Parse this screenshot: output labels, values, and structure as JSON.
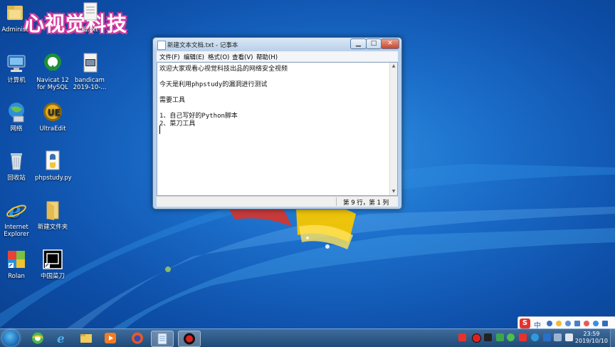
{
  "watermark": "心视觉科技",
  "desktop_icons": [
    {
      "key": "admin",
      "label": "Administ"
    },
    {
      "key": "txtfile",
      "label": "档.txt"
    },
    {
      "key": "computer",
      "label": "计算机"
    },
    {
      "key": "navicat",
      "label": "Navicat 12 for MySQL"
    },
    {
      "key": "bandicam",
      "label": "bandicam 2019-10-..."
    },
    {
      "key": "network",
      "label": "网络"
    },
    {
      "key": "ultraedit",
      "label": "UltraEdit"
    },
    {
      "key": "recycle",
      "label": "回收站"
    },
    {
      "key": "phpstudy",
      "label": "phpstudy.py"
    },
    {
      "key": "ie",
      "label": "Internet Explorer"
    },
    {
      "key": "newfolder",
      "label": "新建文件夹"
    },
    {
      "key": "rolan",
      "label": "Rolan"
    },
    {
      "key": "zhongguocaidao",
      "label": "中国菜刀"
    }
  ],
  "notepad": {
    "title": "新建文本文档.txt - 记事本",
    "menu": [
      "文件(F)",
      "编辑(E)",
      "格式(O)",
      "查看(V)",
      "帮助(H)"
    ],
    "lines": [
      "欢迎大家观看心视觉科技出品的网络安全视频",
      "",
      "今天是利用phpstudy的漏洞进行测试",
      "",
      "需要工具",
      "",
      "1、自己写好的Python脚本",
      "2、菜刀工具"
    ],
    "status": "第 9 行，第 1 列",
    "min_glyph": "▁",
    "max_glyph": "□",
    "close_glyph": "✕"
  },
  "ime": {
    "brand": "S",
    "mode": "中"
  },
  "taskbar": {
    "time": "23:59",
    "date": "2019/10/10"
  },
  "colors": {
    "wallpaper": "#1a6cc8",
    "taskbar": "#2a5686",
    "watermark_outline": "#d93aa0"
  }
}
